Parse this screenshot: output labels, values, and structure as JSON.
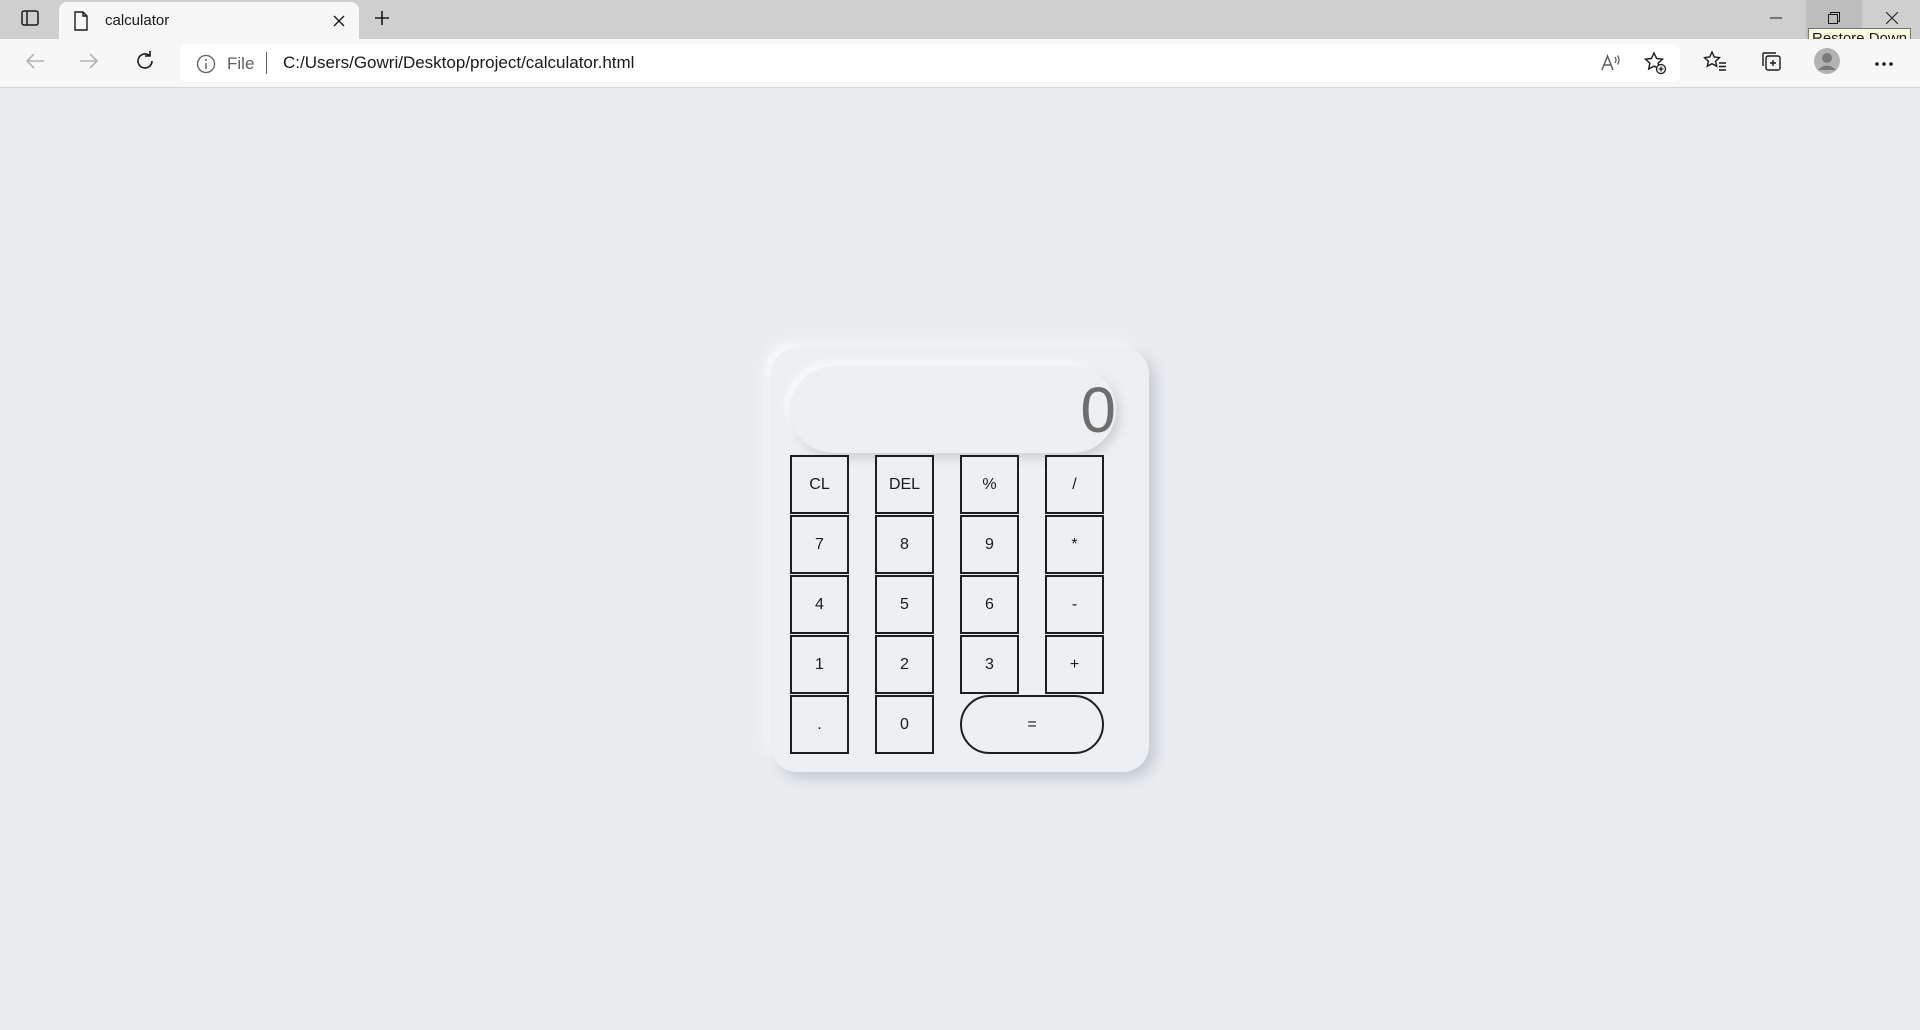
{
  "browser": {
    "tab": {
      "title": "calculator"
    },
    "tooltip": "Restore Down",
    "address": {
      "scheme": "File",
      "url": "C:/Users/Gowri/Desktop/project/calculator.html"
    },
    "icons": [
      "tab-actions-icon",
      "page-icon",
      "close-icon",
      "plus-icon",
      "minimize-icon",
      "restore-icon",
      "close-window-icon",
      "back-arrow-icon",
      "forward-arrow-icon",
      "refresh-icon",
      "info-icon",
      "read-aloud-icon",
      "add-favorite-icon",
      "favorites-icon",
      "collections-icon",
      "profile-icon",
      "more-icon"
    ]
  },
  "calculator": {
    "display": "0",
    "keys": {
      "cl": "CL",
      "del": "DEL",
      "percent": "%",
      "divide": "/",
      "k7": "7",
      "k8": "8",
      "k9": "9",
      "multiply": "*",
      "k4": "4",
      "k5": "5",
      "k6": "6",
      "minus": "-",
      "k1": "1",
      "k2": "2",
      "k3": "3",
      "plus": "+",
      "dot": ".",
      "k0": "0",
      "equals": "="
    }
  },
  "colors": {
    "page_bg": "#e9edf0",
    "tabstrip_bg": "#cfcfcf",
    "toolbar_bg": "#f7f7f7",
    "key_border": "#1e1e1e",
    "display_text": "#6e6e6e"
  }
}
